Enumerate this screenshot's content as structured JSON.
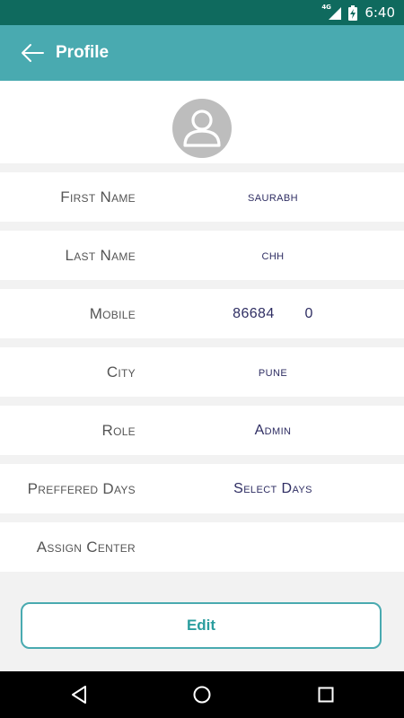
{
  "status": {
    "network": "4G",
    "time": "6:40"
  },
  "appbar": {
    "title": "Profile",
    "back_icon": "arrow-left-icon"
  },
  "avatar": {
    "icon": "person-icon"
  },
  "fields": [
    {
      "label": "First Name",
      "value": "saurabh"
    },
    {
      "label": "Last Name",
      "value": "chh"
    },
    {
      "label": "Mobile",
      "value": "86684       0"
    },
    {
      "label": "City",
      "value": "pune"
    },
    {
      "label": "Role",
      "value": "Admin"
    },
    {
      "label": "Preffered Days",
      "value": "Select Days"
    },
    {
      "label": "Assign Center",
      "value": ""
    }
  ],
  "actions": {
    "edit_label": "Edit"
  },
  "colors": {
    "status_bar": "#0f6a5e",
    "app_bar": "#49aab0",
    "accent": "#2a9d9e",
    "value_text": "#2f2e63"
  }
}
